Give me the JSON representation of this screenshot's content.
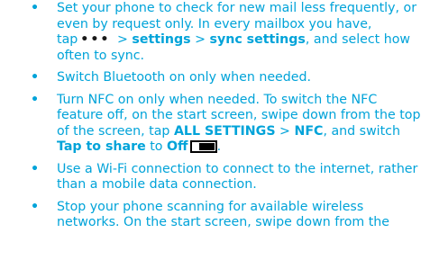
{
  "tips": [
    {
      "part1": "Set your phone to check for new mail less frequently, or even by request only. In every mailbox you have, tap",
      "icon": "•••",
      "sep1": " > ",
      "settings": "settings",
      "sep2": " > ",
      "sync_settings": "sync settings",
      "part2": ", and select how often to sync."
    },
    {
      "text": "Switch Bluetooth on only when needed."
    },
    {
      "part1": "Turn NFC on only when needed. To switch the NFC feature off, on the start screen, swipe down from the top of the screen, tap ",
      "all_settings": "ALL SETTINGS",
      "sep1": " > ",
      "nfc": "NFC",
      "part2": ", and switch ",
      "tap_to_share": "Tap to share",
      "part3": " to ",
      "off": "Off",
      "part4": "."
    },
    {
      "text": "Use a Wi-Fi connection to connect to the internet, rather than a mobile data connection."
    },
    {
      "text": "Stop your phone scanning for available wireless networks. On the start screen, swipe down from the"
    }
  ],
  "colors": {
    "text": "#00a3d9",
    "bullet": "#00a3d9"
  }
}
